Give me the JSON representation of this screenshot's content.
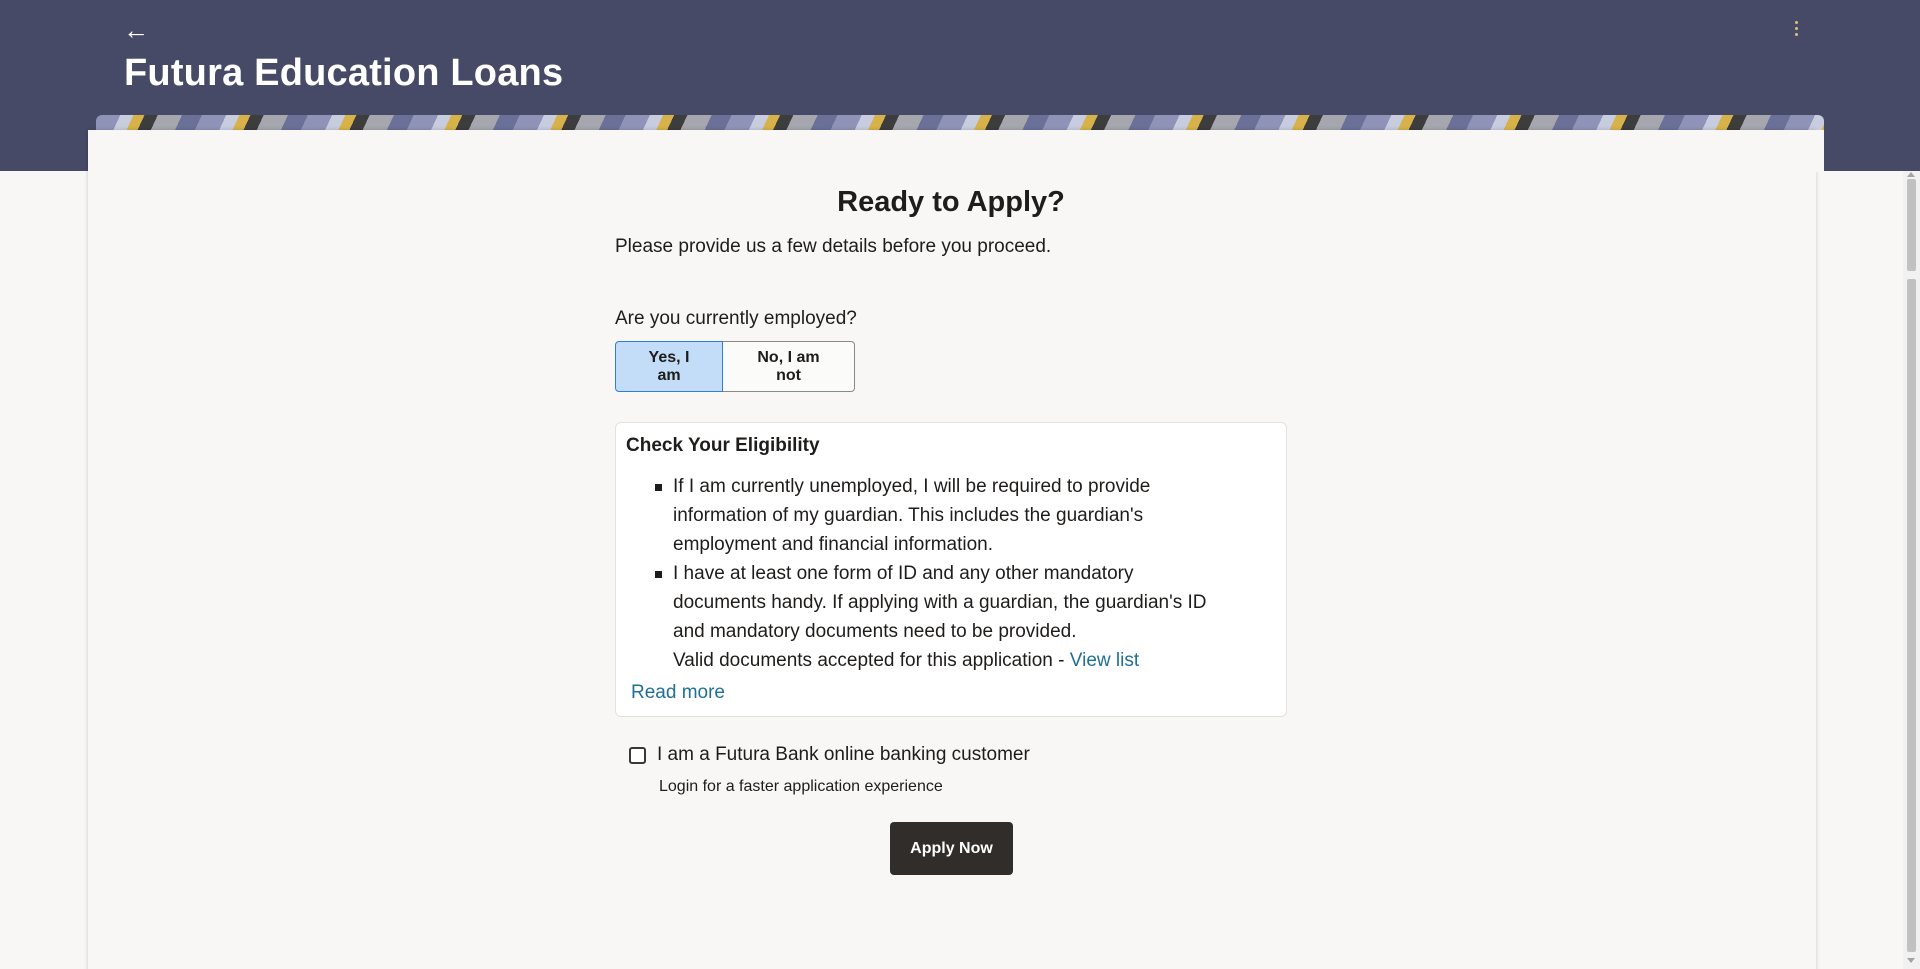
{
  "header": {
    "title": "Futura Education Loans",
    "back_icon": "←",
    "menu_icon": "kebab-menu"
  },
  "main": {
    "heading": "Ready to Apply?",
    "subtitle": "Please provide us a few details before you proceed.",
    "employment_question": "Are you currently employed?",
    "employment_options": [
      {
        "label": "Yes, I am",
        "selected": true
      },
      {
        "label": "No, I am not",
        "selected": false
      }
    ],
    "eligibility": {
      "title": "Check Your Eligibility",
      "items": [
        "If I am currently unemployed, I will be required to provide information of my guardian. This includes the guardian's employment and financial information.",
        "I have at least one form of ID and any other mandatory documents handy. If applying with a guardian, the guardian's ID and mandatory documents need to be provided."
      ],
      "valid_docs_text": "Valid documents accepted for this application - ",
      "view_list_link": "View list",
      "read_more": "Read more"
    },
    "customer_checkbox": {
      "label": "I am a Futura Bank online banking customer",
      "hint": "Login for a faster application experience",
      "checked": false
    },
    "apply_button": "Apply Now"
  },
  "colors": {
    "header_bg": "#464a66",
    "selected_option_bg": "#c3dcf7",
    "selected_option_border": "#2f7fcf",
    "link": "#1f6f98",
    "primary_button": "#312d2a"
  }
}
